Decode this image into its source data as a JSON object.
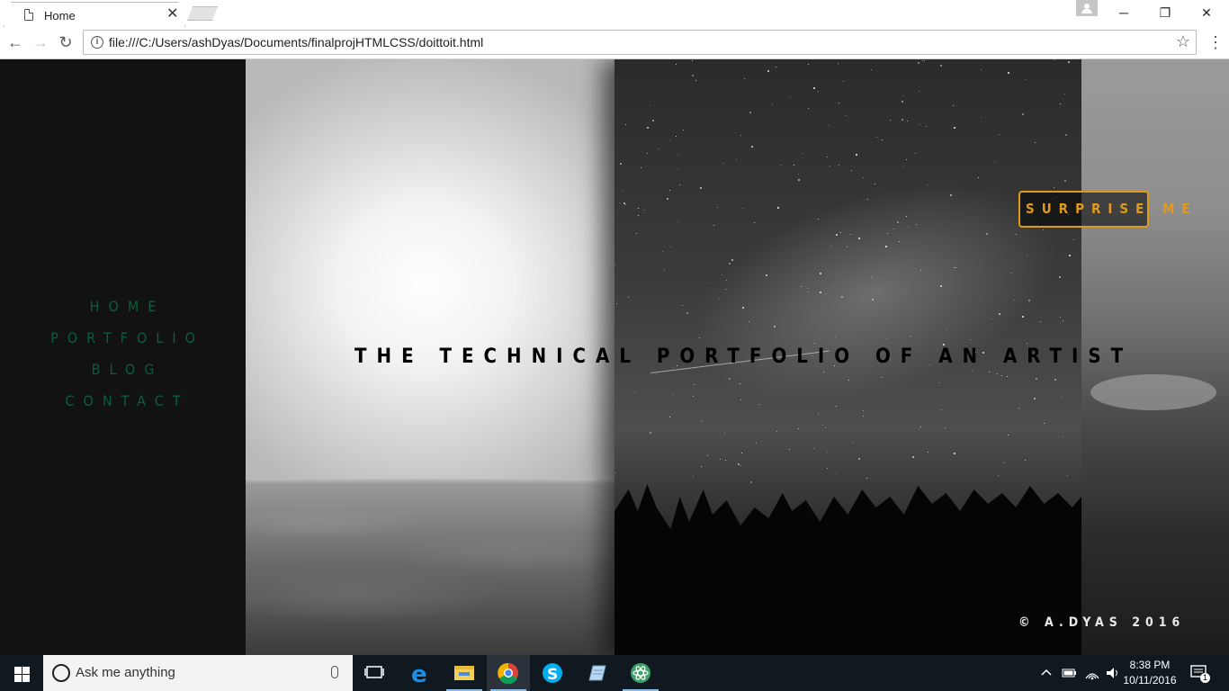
{
  "browser": {
    "tab_title": "Home",
    "tab_close": "✕",
    "url": "file:///C:/Users/ashDyas/Documents/finalprojHTMLCSS/doittoit.html",
    "window_minimize": "─",
    "window_restore": "❐",
    "window_close": "✕",
    "back": "←",
    "forward": "→",
    "reload": "↻",
    "star": "☆",
    "menu": "⋮",
    "info": "i"
  },
  "site": {
    "nav": [
      "HOME",
      "PORTFOLIO",
      "BLOG",
      "CONTACT"
    ],
    "hero_title": "THE TECHNICAL PORTFOLIO OF AN ARTIST",
    "surprise_label": "SURPRISE ME",
    "copyright": "© A.DYAS 2016",
    "colors": {
      "nav": "#0b5d3d",
      "accent": "#e09a1b",
      "sidebar": "#121212"
    }
  },
  "taskbar": {
    "search_placeholder": "Ask me anything",
    "time": "8:38 PM",
    "date": "10/11/2016",
    "notification_count": "1",
    "apps": [
      "task-view-icon",
      "edge-icon",
      "file-explorer-icon",
      "chrome-icon",
      "skype-icon",
      "notepad-icon",
      "atom-icon"
    ]
  }
}
